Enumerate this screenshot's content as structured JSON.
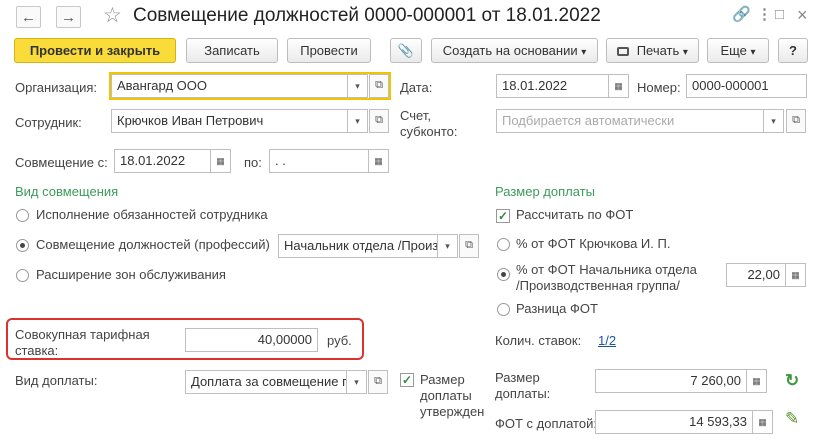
{
  "window": {
    "title": "Совмещение должностей 0000-000001 от 18.01.2022",
    "nav_back": "←",
    "nav_forward": "→",
    "favorite": "☆",
    "link": "🔗",
    "more": "⋮",
    "maximize": "□",
    "close": "×"
  },
  "toolbar": {
    "post_close": "Провести и закрыть",
    "save": "Записать",
    "post": "Провести",
    "attach": "📎",
    "create_based": "Создать на основании",
    "print": "Печать",
    "more": "Еще",
    "help": "?",
    "dropdown": "▾"
  },
  "form": {
    "org_label": "Организация:",
    "org_value": "Авангард ООО",
    "date_label": "Дата:",
    "date_value": "18.01.2022",
    "number_label": "Номер:",
    "number_value": "0000-000001",
    "employee_label": "Сотрудник:",
    "employee_value": "Крючков Иван Петрович",
    "account_label_1": "Счет,",
    "account_label_2": "субконто:",
    "account_placeholder": "Подбирается автоматически",
    "combo_from_label": "Совмещение с:",
    "combo_from_value": "18.01.2022",
    "combo_to_label": "по:",
    "combo_to_value": " .  .",
    "type_section": "Вид совмещения",
    "type_options": [
      "Исполнение обязанностей сотрудника",
      "Совмещение должностей (профессий)",
      "Расширение зон обслуживания"
    ],
    "position_value": "Начальник отдела /Произ",
    "rate_label_1": "Совокупная тарифная",
    "rate_label_2": "ставка:",
    "rate_value": "40,00000",
    "rate_unit": "руб.",
    "payment_type_label": "Вид доплаты:",
    "payment_type_value": "Доплата за совмещение г",
    "amount_approved_1": "Размер",
    "amount_approved_2": "доплаты",
    "amount_approved_3": "утвержден",
    "bonus_section": "Размер доплаты",
    "calc_by_fot": "Рассчитать по ФОТ",
    "bonus_options": [
      "% от ФОТ Крючкова И. П.",
      "% от ФОТ Начальника отдела",
      "Разница ФОТ"
    ],
    "bonus_option2_line2": "/Производственная группа/",
    "percent_value": "22,00",
    "rates_count_label": "Колич. ставок:",
    "rates_count_value": "1/2",
    "bonus_amount_label_1": "Размер",
    "bonus_amount_label_2": "доплаты:",
    "bonus_amount_value": "7 260,00",
    "fot_with_bonus_label": "ФОТ с доплатой:",
    "fot_with_bonus_value": "14 593,33"
  },
  "icons": {
    "dropdown": "▾",
    "open": "⧉",
    "calendar": "▦",
    "calculator": "▦",
    "refresh": "↻",
    "edit": "✎",
    "check": "✓"
  },
  "colors": {
    "accent_yellow": "#f9dc3a",
    "section_green": "#3d9b5a",
    "highlight_red": "#d9342b",
    "link_blue": "#1a55a6"
  }
}
